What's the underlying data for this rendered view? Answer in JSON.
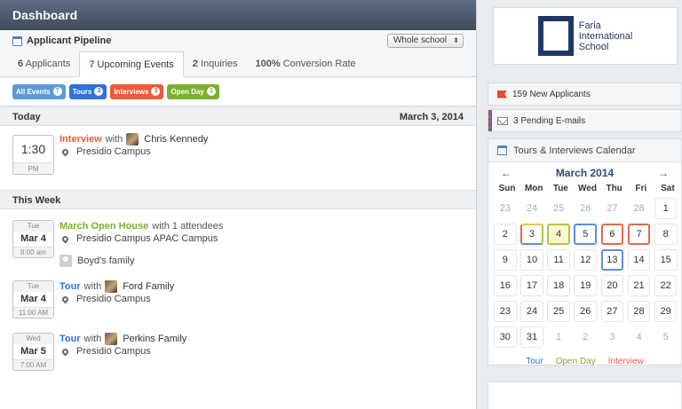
{
  "header": {
    "title": "Dashboard"
  },
  "pipeline": {
    "title": "Applicant Pipeline",
    "school_select": "Whole school",
    "tabs": [
      {
        "count": "6",
        "label": "Applicants"
      },
      {
        "count": "7",
        "label": "Upcoming Events"
      },
      {
        "count": "2",
        "label": "Inquiries"
      },
      {
        "count": "100%",
        "label": "Conversion Rate"
      }
    ]
  },
  "filters": [
    {
      "label": "All Events",
      "count": "7"
    },
    {
      "label": "Tours",
      "count": "3"
    },
    {
      "label": "Interviews",
      "count": "3"
    },
    {
      "label": "Open Day",
      "count": "1"
    }
  ],
  "today": {
    "heading": "Today",
    "date": "March 3, 2014",
    "event": {
      "time": "1:30",
      "ampm": "PM",
      "type": "Interview",
      "with": "with",
      "person": "Chris Kennedy",
      "location": "Presidio Campus"
    }
  },
  "this_week": {
    "heading": "This Week",
    "events": [
      {
        "dow": "Tue",
        "day": "Mar 4",
        "time": "8:00 am",
        "type": "March Open House",
        "with": "with 1 attendees",
        "location": "Presidio Campus APAC Campus",
        "attendee": "Boyd's family"
      },
      {
        "dow": "Tue",
        "day": "Mar 4",
        "time": "11:00 AM",
        "type": "Tour",
        "with": "with",
        "person": "Ford Family",
        "location": "Presidio Campus"
      },
      {
        "dow": "Wed",
        "day": "Mar 5",
        "time": "7:00 AM",
        "type": "Tour",
        "with": "with",
        "person": "Perkins Family",
        "location": "Presidio Campus"
      }
    ]
  },
  "logo": {
    "line1": "Faria",
    "line2": "International",
    "line3": "School"
  },
  "stats": {
    "new_applicants": "159 New Applicants",
    "pending_emails": "3 Pending E-mails"
  },
  "calendar": {
    "title": "Tours & Interviews Calendar",
    "month": "March 2014",
    "prev": "←",
    "next": "→",
    "weekdays": [
      "Sun",
      "Mon",
      "Tue",
      "Wed",
      "Thu",
      "Fri",
      "Sat"
    ],
    "weeks": [
      [
        "23",
        "24",
        "25",
        "26",
        "27",
        "28",
        "1"
      ],
      [
        "2",
        "3",
        "4",
        "5",
        "6",
        "7",
        "8"
      ],
      [
        "9",
        "10",
        "11",
        "12",
        "13",
        "14",
        "15"
      ],
      [
        "16",
        "17",
        "18",
        "19",
        "20",
        "21",
        "22"
      ],
      [
        "23",
        "24",
        "25",
        "26",
        "27",
        "28",
        "29"
      ],
      [
        "30",
        "31",
        "1",
        "2",
        "3",
        "4",
        "5"
      ]
    ],
    "legend": {
      "tour": "Tour",
      "open_day": "Open Day",
      "interview": "Interview"
    },
    "colors": {
      "tour": "#2f72d8",
      "open_day": "#7cb02c",
      "interview": "#ee5a3a"
    }
  }
}
